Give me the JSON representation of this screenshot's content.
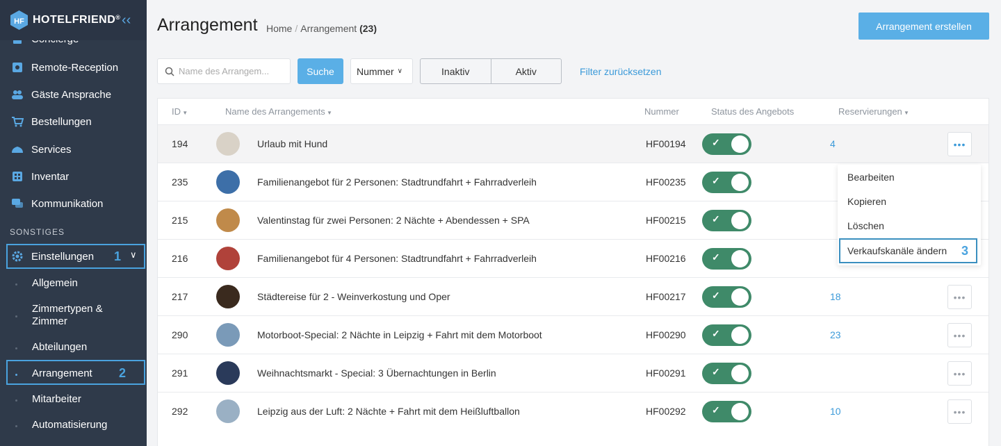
{
  "app": {
    "brand": "HOTELFRIEND",
    "brand_reg": "®"
  },
  "sidebar": {
    "items": [
      {
        "label": "Concierge",
        "icon": "concierge-icon"
      },
      {
        "label": "Remote-Reception",
        "icon": "remote-reception-icon"
      },
      {
        "label": "Gäste Ansprache",
        "icon": "guests-icon"
      },
      {
        "label": "Bestellungen",
        "icon": "cart-icon"
      },
      {
        "label": "Services",
        "icon": "cloud-icon"
      },
      {
        "label": "Inventar",
        "icon": "inventory-icon"
      },
      {
        "label": "Kommunikation",
        "icon": "chat-icon"
      }
    ],
    "section_label": "SONSTIGES",
    "settings": {
      "label": "Einstellungen",
      "step": "1",
      "icon": "gear-icon"
    },
    "sub_items": [
      {
        "label": "Allgemein"
      },
      {
        "label": "Zimmertypen & Zimmer"
      },
      {
        "label": "Abteilungen"
      },
      {
        "label": "Arrangement",
        "step": "2"
      },
      {
        "label": "Mitarbeiter"
      },
      {
        "label": "Automatisierung"
      }
    ]
  },
  "header": {
    "title": "Arrangement",
    "breadcrumb_home": "Home",
    "breadcrumb_sep": "/",
    "breadcrumb_current": "Arrangement",
    "breadcrumb_count": "(23)",
    "create_button": "Arrangement erstellen"
  },
  "filters": {
    "search_placeholder": "Name des Arrangem...",
    "search_button": "Suche",
    "select_value": "Nummer",
    "seg_inactive": "Inaktiv",
    "seg_active": "Aktiv",
    "reset_link": "Filter zurücksetzen"
  },
  "table": {
    "headers": {
      "id": "ID",
      "name": "Name des Arrangements",
      "number": "Nummer",
      "status": "Status des Angebots",
      "reservations": "Reservierungen"
    },
    "rows": [
      {
        "id": "194",
        "name": "Urlaub mit Hund",
        "number": "HF00194",
        "active": true,
        "reservations": "4",
        "thumb": "#d9d2c7"
      },
      {
        "id": "235",
        "name": "Familienangebot für 2 Personen: Stadtrundfahrt + Fahrradverleih",
        "number": "HF00235",
        "active": true,
        "reservations": "",
        "thumb": "#3d6fa8"
      },
      {
        "id": "215",
        "name": "Valentinstag für zwei Personen: 2 Nächte + Abendessen + SPA",
        "number": "HF00215",
        "active": true,
        "reservations": "",
        "thumb": "#c08a4a"
      },
      {
        "id": "216",
        "name": "Familienangebot für 4 Personen: Stadtrundfahrt + Fahrradverleih",
        "number": "HF00216",
        "active": true,
        "reservations": "",
        "thumb": "#b0423a"
      },
      {
        "id": "217",
        "name": "Städtereise für 2 - Weinverkostung und Oper",
        "number": "HF00217",
        "active": true,
        "reservations": "18",
        "thumb": "#3a2a1e"
      },
      {
        "id": "290",
        "name": "Motorboot-Special: 2 Nächte in Leipzig + Fahrt mit dem Motorboot",
        "number": "HF00290",
        "active": true,
        "reservations": "23",
        "thumb": "#7a9ab8"
      },
      {
        "id": "291",
        "name": "Weihnachtsmarkt - Special: 3 Übernachtungen in Berlin",
        "number": "HF00291",
        "active": true,
        "reservations": "",
        "thumb": "#2a3a5a"
      },
      {
        "id": "292",
        "name": "Leipzig aus der Luft: 2 Nächte + Fahrt mit dem Heißluftballon",
        "number": "HF00292",
        "active": true,
        "reservations": "10",
        "thumb": "#9ab0c4"
      }
    ]
  },
  "menu": {
    "items": [
      {
        "label": "Bearbeiten"
      },
      {
        "label": "Kopieren"
      },
      {
        "label": "Löschen"
      },
      {
        "label": "Verkaufskanäle ändern",
        "step": "3"
      }
    ]
  },
  "colors": {
    "sidebar_bg": "#2f3a4a",
    "accent": "#5aafe6",
    "toggle_on": "#3f8a69",
    "link": "#3b9ad9"
  }
}
